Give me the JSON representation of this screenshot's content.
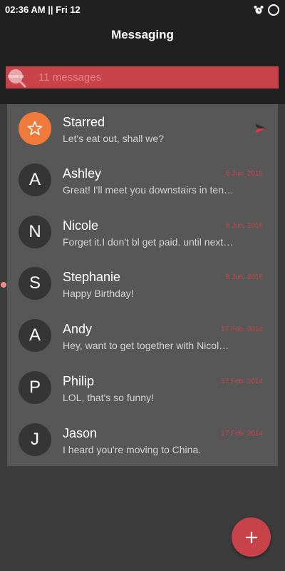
{
  "status_bar": {
    "time": "02:36 AM || Fri 12",
    "icons": [
      "alarm-clock-icon",
      "ring-icon"
    ]
  },
  "header": {
    "title": "Messaging"
  },
  "search": {
    "icon_label": "SEARCH",
    "placeholder": "11 messages",
    "value": "",
    "color": "#c8424a"
  },
  "conversations": [
    {
      "initial": "",
      "name": "Starred",
      "preview": "Let's eat out, shall we?",
      "date": "",
      "icon": "star-icon",
      "trailing_icon": "send-icon",
      "avatar_color": "#f07a3c"
    },
    {
      "initial": "A",
      "name": "Ashley",
      "preview": "Great! I'll meet you downstairs in ten minutes.",
      "date": "8 Jun. 2016"
    },
    {
      "initial": "N",
      "name": "Nicole",
      "preview": "Forget it.I don't bl get paid. until next week.",
      "date": "8 Jun. 2016"
    },
    {
      "initial": "S",
      "name": "Stephanie",
      "preview": "Happy Birthday!",
      "date": "8 Jun. 2016",
      "unread": true
    },
    {
      "initial": "A",
      "name": "Andy",
      "preview": "Hey, want to get together with Nicole tonight?",
      "date": "17 Feb. 2014"
    },
    {
      "initial": "P",
      "name": "Philip",
      "preview": "LOL, that's so funny!",
      "date": "17 Feb. 2014"
    },
    {
      "initial": "J",
      "name": "Jason",
      "preview": "I heard you're moving to China.",
      "date": "17 Feb. 2014"
    }
  ],
  "fab": {
    "icon": "plus-icon",
    "color": "#c8424a"
  },
  "colors": {
    "accent": "#c8424a",
    "date": "#c9454c",
    "header_bg": "#202020",
    "list_bg": "#575757",
    "page_bg": "#3c3c3c"
  }
}
